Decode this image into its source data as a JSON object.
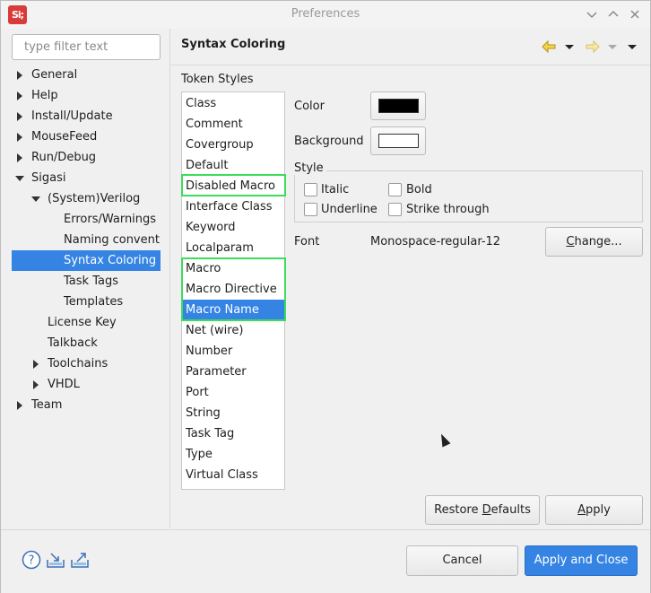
{
  "window": {
    "title": "Preferences",
    "app_icon_text": "Si;"
  },
  "filter": {
    "placeholder": "type filter text",
    "value": ""
  },
  "tree": [
    {
      "label": "General",
      "depth": 0,
      "arrow": "right"
    },
    {
      "label": "Help",
      "depth": 0,
      "arrow": "right"
    },
    {
      "label": "Install/Update",
      "depth": 0,
      "arrow": "right"
    },
    {
      "label": "MouseFeed",
      "depth": 0,
      "arrow": "right"
    },
    {
      "label": "Run/Debug",
      "depth": 0,
      "arrow": "right"
    },
    {
      "label": "Sigasi",
      "depth": 0,
      "arrow": "down"
    },
    {
      "label": "(System)Verilog",
      "depth": 1,
      "arrow": "down"
    },
    {
      "label": "Errors/Warnings",
      "depth": 2,
      "arrow": ""
    },
    {
      "label": "Naming convent",
      "depth": 2,
      "arrow": ""
    },
    {
      "label": "Syntax Coloring",
      "depth": 2,
      "arrow": "",
      "selected": true
    },
    {
      "label": "Task Tags",
      "depth": 2,
      "arrow": ""
    },
    {
      "label": "Templates",
      "depth": 2,
      "arrow": ""
    },
    {
      "label": "License Key",
      "depth": 1,
      "arrow": ""
    },
    {
      "label": "Talkback",
      "depth": 1,
      "arrow": ""
    },
    {
      "label": "Toolchains",
      "depth": 1,
      "arrow": "right"
    },
    {
      "label": "VHDL",
      "depth": 1,
      "arrow": "right"
    },
    {
      "label": "Team",
      "depth": 0,
      "arrow": "right"
    }
  ],
  "page": {
    "title": "Syntax Coloring"
  },
  "token_styles": {
    "label": "Token Styles",
    "items": [
      "Class",
      "Comment",
      "Covergroup",
      "Default",
      "Disabled Macro",
      "Interface Class",
      "Keyword",
      "Localparam",
      "Macro",
      "Macro Directive",
      "Macro Name",
      "Net (wire)",
      "Number",
      "Parameter",
      "Port",
      "String",
      "Task Tag",
      "Type",
      "Virtual Class"
    ],
    "selected": "Macro Name"
  },
  "color": {
    "label": "Color",
    "value": "#000000"
  },
  "background": {
    "label": "Background",
    "value": "#ffffff"
  },
  "style": {
    "label": "Style",
    "italic": {
      "label": "Italic",
      "checked": false
    },
    "bold": {
      "label": "Bold",
      "checked": false
    },
    "underline": {
      "label": "Underline",
      "checked": false
    },
    "strike": {
      "label": "Strike through",
      "checked": false
    }
  },
  "font": {
    "label": "Font",
    "value": "Monospace-regular-12",
    "change_label": "Change..."
  },
  "buttons": {
    "restore_defaults": "Restore Defaults",
    "apply": "Apply",
    "cancel": "Cancel",
    "apply_close": "Apply and Close"
  },
  "colors": {
    "accent": "#3584e4",
    "highlight": "#3ddc5c",
    "logo": "#d93a3a",
    "nav_arrow": "#e8c23a"
  },
  "icons": [
    "back-arrow-icon",
    "forward-arrow-icon",
    "menu-chevron-icon",
    "help-icon",
    "import-icon",
    "export-icon",
    "minimize-icon",
    "maximize-icon"
  ]
}
